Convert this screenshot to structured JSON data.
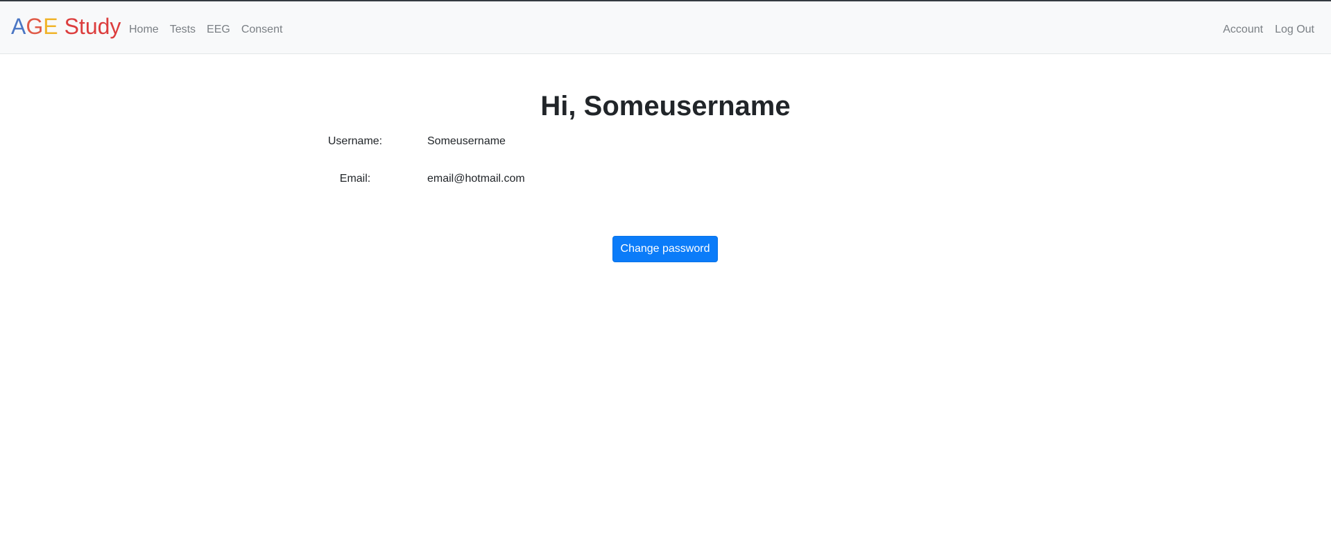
{
  "brand": {
    "letters": [
      "A",
      "G",
      "E"
    ],
    "word": "Study",
    "colors": {
      "a": "#4a76c4",
      "g": "#e05a47",
      "e": "#f0b429",
      "study": "#dc3d3d"
    }
  },
  "nav": {
    "left": [
      {
        "label": "Home"
      },
      {
        "label": "Tests"
      },
      {
        "label": "EEG"
      },
      {
        "label": "Consent"
      }
    ],
    "right": [
      {
        "label": "Account"
      },
      {
        "label": "Log Out"
      }
    ]
  },
  "profile": {
    "greeting": "Hi, Someusername",
    "username_label": "Username:",
    "username": "Someusername",
    "email_label": "Email:",
    "email": "email@hotmail.com"
  },
  "actions": {
    "change_password_label": "Change password"
  },
  "colors": {
    "primary": "#0b7cf9",
    "navbar_bg": "#f8f9fa",
    "nav_link": "#7a7f84"
  }
}
